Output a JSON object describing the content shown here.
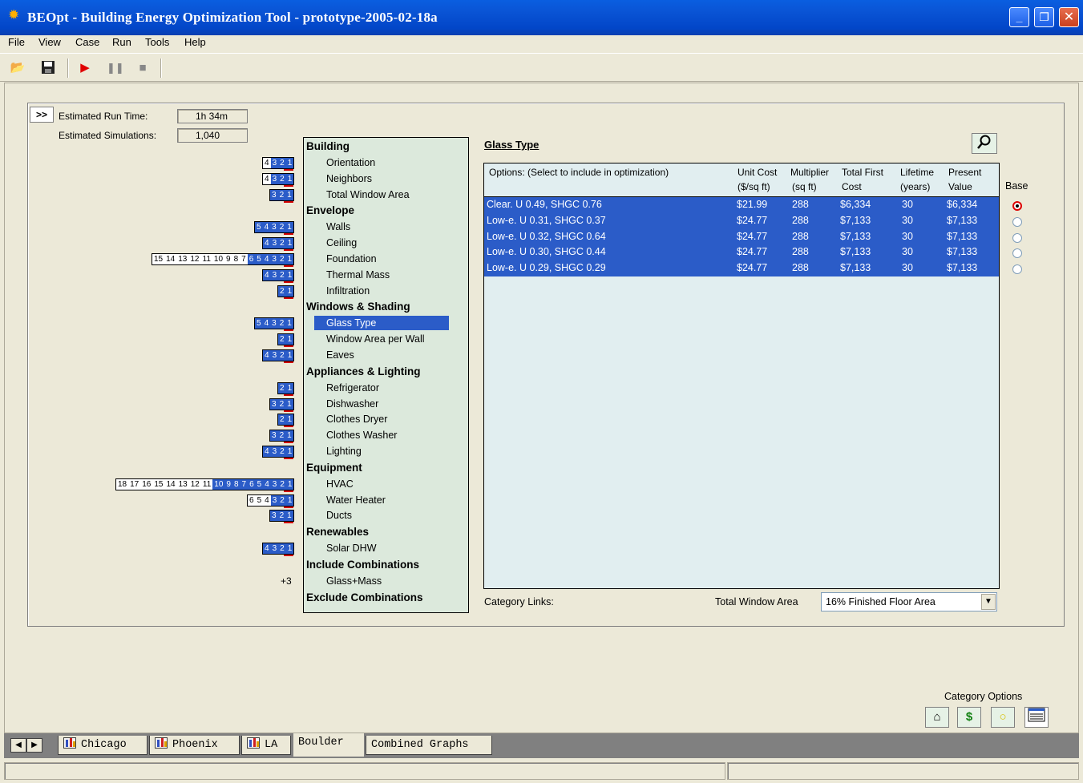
{
  "window": {
    "title": "BEOpt - Building Energy Optimization Tool   -   prototype-2005-02-18a",
    "minimize": "_",
    "restore": "❐",
    "close": "✕"
  },
  "menu": [
    "File",
    "View",
    "Case",
    "Run",
    "Tools",
    "Help"
  ],
  "run_info": {
    "expand_label": ">>",
    "run_time_label": "Estimated Run Time:",
    "run_time_value": "1h 34m",
    "simulations_label": "Estimated Simulations:",
    "simulations_value": "1,040"
  },
  "categories": [
    {
      "type": "header",
      "label": "Building"
    },
    {
      "type": "item",
      "label": "Orientation",
      "levels": [
        "4",
        "3",
        "2",
        "1"
      ],
      "on": 3
    },
    {
      "type": "item",
      "label": "Neighbors",
      "levels": [
        "4",
        "3",
        "2",
        "1"
      ],
      "on": 3
    },
    {
      "type": "item",
      "label": "Total Window Area",
      "levels": [
        "3",
        "2",
        "1"
      ],
      "on": 3
    },
    {
      "type": "header",
      "label": "Envelope"
    },
    {
      "type": "item",
      "label": "Walls",
      "levels": [
        "5",
        "4",
        "3",
        "2",
        "1"
      ],
      "on": 5
    },
    {
      "type": "item",
      "label": "Ceiling",
      "levels": [
        "4",
        "3",
        "2",
        "1"
      ],
      "on": 4
    },
    {
      "type": "item",
      "label": "Foundation",
      "levels": [
        "15",
        "14",
        "13",
        "12",
        "11",
        "10",
        "9",
        "8",
        "7",
        "6",
        "5",
        "4",
        "3",
        "2",
        "1"
      ],
      "on": 6
    },
    {
      "type": "item",
      "label": "Thermal Mass",
      "levels": [
        "4",
        "3",
        "2",
        "1"
      ],
      "on": 4
    },
    {
      "type": "item",
      "label": "Infiltration",
      "levels": [
        "2",
        "1"
      ],
      "on": 2
    },
    {
      "type": "header",
      "label": "Windows & Shading"
    },
    {
      "type": "item",
      "label": "Glass Type",
      "levels": [
        "5",
        "4",
        "3",
        "2",
        "1"
      ],
      "on": 5,
      "selected": true
    },
    {
      "type": "item",
      "label": "Window Area per Wall",
      "levels": [
        "2",
        "1"
      ],
      "on": 2
    },
    {
      "type": "item",
      "label": "Eaves",
      "levels": [
        "4",
        "3",
        "2",
        "1"
      ],
      "on": 4
    },
    {
      "type": "header",
      "label": "Appliances & Lighting"
    },
    {
      "type": "item",
      "label": "Refrigerator",
      "levels": [
        "2",
        "1"
      ],
      "on": 2
    },
    {
      "type": "item",
      "label": "Dishwasher",
      "levels": [
        "3",
        "2",
        "1"
      ],
      "on": 3
    },
    {
      "type": "item",
      "label": "Clothes Dryer",
      "levels": [
        "2",
        "1"
      ],
      "on": 2
    },
    {
      "type": "item",
      "label": "Clothes Washer",
      "levels": [
        "3",
        "2",
        "1"
      ],
      "on": 3
    },
    {
      "type": "item",
      "label": "Lighting",
      "levels": [
        "4",
        "3",
        "2",
        "1"
      ],
      "on": 4
    },
    {
      "type": "header",
      "label": "Equipment"
    },
    {
      "type": "item",
      "label": "HVAC",
      "levels": [
        "18",
        "17",
        "16",
        "15",
        "14",
        "13",
        "12",
        "11",
        "10",
        "9",
        "8",
        "7",
        "6",
        "5",
        "4",
        "3",
        "2",
        "1"
      ],
      "on": 10
    },
    {
      "type": "item",
      "label": "Water Heater",
      "levels": [
        "6",
        "5",
        "4",
        "3",
        "2",
        "1"
      ],
      "on": 3
    },
    {
      "type": "item",
      "label": "Ducts",
      "levels": [
        "3",
        "2",
        "1"
      ],
      "on": 3
    },
    {
      "type": "header",
      "label": "Renewables"
    },
    {
      "type": "item",
      "label": "Solar DHW",
      "levels": [
        "4",
        "3",
        "2",
        "1"
      ],
      "on": 4
    },
    {
      "type": "header",
      "label": "Include Combinations"
    },
    {
      "type": "item",
      "label": "Glass+Mass",
      "extra": "+3"
    },
    {
      "type": "header",
      "label": "Exclude Combinations"
    }
  ],
  "glass": {
    "title": "Glass Type",
    "headers": {
      "options": "Options: (Select to include in optimization)",
      "unit_cost": [
        "Unit Cost",
        "($/sq ft)"
      ],
      "multiplier": [
        "Multiplier",
        "(sq ft)"
      ],
      "first_cost": [
        "Total First",
        "Cost"
      ],
      "lifetime": [
        "Lifetime",
        "(years)"
      ],
      "present": [
        "Present",
        "Value"
      ],
      "base": "Base"
    },
    "rows": [
      {
        "name": "Clear.  U 0.49, SHGC 0.76",
        "unit_cost": "$21.99",
        "mult": "288",
        "first": "$6,334",
        "life": "30",
        "pv": "$6,334",
        "base": true
      },
      {
        "name": "Low-e.  U 0.31, SHGC 0.37",
        "unit_cost": "$24.77",
        "mult": "288",
        "first": "$7,133",
        "life": "30",
        "pv": "$7,133",
        "base": false
      },
      {
        "name": "Low-e.  U 0.32, SHGC 0.64",
        "unit_cost": "$24.77",
        "mult": "288",
        "first": "$7,133",
        "life": "30",
        "pv": "$7,133",
        "base": false
      },
      {
        "name": "Low-e.  U 0.30, SHGC 0.44",
        "unit_cost": "$24.77",
        "mult": "288",
        "first": "$7,133",
        "life": "30",
        "pv": "$7,133",
        "base": false
      },
      {
        "name": "Low-e.  U 0.29, SHGC 0.29",
        "unit_cost": "$24.77",
        "mult": "288",
        "first": "$7,133",
        "life": "30",
        "pv": "$7,133",
        "base": false
      }
    ],
    "category_links_label": "Category Links:",
    "twa_label": "Total Window Area",
    "twa_value": "16% Finished Floor Area"
  },
  "category_options_label": "Category Options",
  "tabs": [
    "Chicago",
    "Phoenix",
    "LA",
    "Boulder",
    "Combined Graphs"
  ],
  "active_tab": "Boulder",
  "colors": {
    "selection": "#2b5cc8",
    "tree_bg": "#dce9dc",
    "table_bg": "#e1eef0",
    "titlebar": "#0a55d6"
  }
}
